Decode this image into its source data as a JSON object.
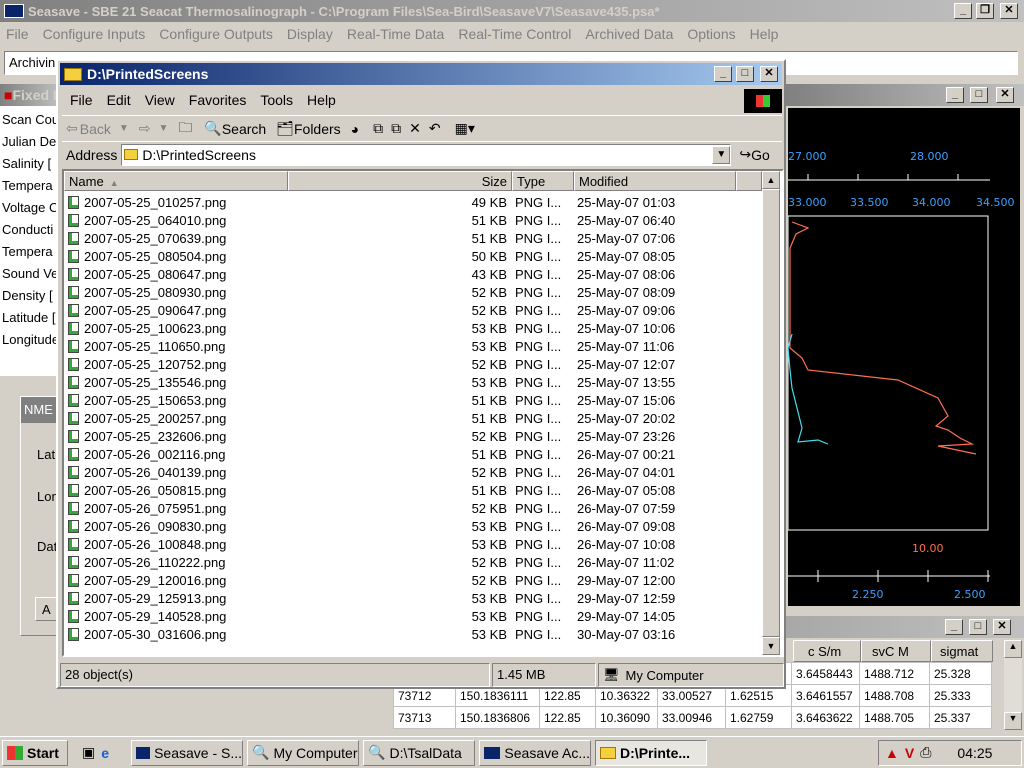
{
  "seasave": {
    "title": "Seasave - SBE 21 Seacat Thermosalinograph - C:\\Program Files\\Sea-Bird\\SeasaveV7\\Seasave435.psa*",
    "menu": [
      "File",
      "Configure Inputs",
      "Configure Outputs",
      "Display",
      "Real-Time Data",
      "Real-Time Control",
      "Archived Data",
      "Options",
      "Help"
    ],
    "status": "Archivin",
    "fixed_title": "Fixed D",
    "fixed_labels": [
      "Scan Cou",
      "Julian De",
      "Salinity [",
      "Tempera",
      "Voltage C",
      "Conducti",
      "Tempera",
      "Sound Ve",
      "Density [",
      "Latitude [",
      "Longitude"
    ],
    "nmea": {
      "title": "NME",
      "labels": [
        "Lati",
        "Lon",
        "Dat"
      ],
      "button": "A"
    },
    "plot": {
      "top_ticks1": [
        "27.000",
        "28.000"
      ],
      "top_ticks2": [
        "33.000",
        "33.500",
        "34.000",
        "34.500"
      ],
      "bottom_ticks1": [
        "10.00"
      ],
      "bottom_ticks2": [
        "2.250",
        "2.500"
      ]
    },
    "grid": {
      "headers": [
        "c S/m",
        "svC M",
        "sigmat"
      ],
      "rows": [
        [
          "",
          "",
          "",
          "",
          "",
          "",
          "3.6458443",
          "1488.712",
          "25.328"
        ],
        [
          "73712",
          "150.1836111",
          "122.85",
          "10.36322",
          "33.00527",
          "1.62515",
          "3.6461557",
          "1488.708",
          "25.333"
        ],
        [
          "73713",
          "150.1836806",
          "122.85",
          "10.36090",
          "33.00946",
          "1.62759",
          "3.6463622",
          "1488.705",
          "25.337"
        ]
      ]
    }
  },
  "explorer": {
    "title": "D:\\PrintedScreens",
    "menu": [
      "File",
      "Edit",
      "View",
      "Favorites",
      "Tools",
      "Help"
    ],
    "toolbar": {
      "back": "Back",
      "search": "Search",
      "folders": "Folders"
    },
    "address_label": "Address",
    "address": "D:\\PrintedScreens",
    "go": "Go",
    "columns": [
      "Name",
      "Size",
      "Type",
      "Modified"
    ],
    "files": [
      [
        "2007-05-25_010257.png",
        "49 KB",
        "PNG I...",
        "25-May-07 01:03"
      ],
      [
        "2007-05-25_064010.png",
        "51 KB",
        "PNG I...",
        "25-May-07 06:40"
      ],
      [
        "2007-05-25_070639.png",
        "51 KB",
        "PNG I...",
        "25-May-07 07:06"
      ],
      [
        "2007-05-25_080504.png",
        "50 KB",
        "PNG I...",
        "25-May-07 08:05"
      ],
      [
        "2007-05-25_080647.png",
        "43 KB",
        "PNG I...",
        "25-May-07 08:06"
      ],
      [
        "2007-05-25_080930.png",
        "52 KB",
        "PNG I...",
        "25-May-07 08:09"
      ],
      [
        "2007-05-25_090647.png",
        "52 KB",
        "PNG I...",
        "25-May-07 09:06"
      ],
      [
        "2007-05-25_100623.png",
        "53 KB",
        "PNG I...",
        "25-May-07 10:06"
      ],
      [
        "2007-05-25_110650.png",
        "53 KB",
        "PNG I...",
        "25-May-07 11:06"
      ],
      [
        "2007-05-25_120752.png",
        "52 KB",
        "PNG I...",
        "25-May-07 12:07"
      ],
      [
        "2007-05-25_135546.png",
        "53 KB",
        "PNG I...",
        "25-May-07 13:55"
      ],
      [
        "2007-05-25_150653.png",
        "51 KB",
        "PNG I...",
        "25-May-07 15:06"
      ],
      [
        "2007-05-25_200257.png",
        "51 KB",
        "PNG I...",
        "25-May-07 20:02"
      ],
      [
        "2007-05-25_232606.png",
        "52 KB",
        "PNG I...",
        "25-May-07 23:26"
      ],
      [
        "2007-05-26_002116.png",
        "51 KB",
        "PNG I...",
        "26-May-07 00:21"
      ],
      [
        "2007-05-26_040139.png",
        "52 KB",
        "PNG I...",
        "26-May-07 04:01"
      ],
      [
        "2007-05-26_050815.png",
        "51 KB",
        "PNG I...",
        "26-May-07 05:08"
      ],
      [
        "2007-05-26_075951.png",
        "52 KB",
        "PNG I...",
        "26-May-07 07:59"
      ],
      [
        "2007-05-26_090830.png",
        "53 KB",
        "PNG I...",
        "26-May-07 09:08"
      ],
      [
        "2007-05-26_100848.png",
        "53 KB",
        "PNG I...",
        "26-May-07 10:08"
      ],
      [
        "2007-05-26_110222.png",
        "52 KB",
        "PNG I...",
        "26-May-07 11:02"
      ],
      [
        "2007-05-29_120016.png",
        "52 KB",
        "PNG I...",
        "29-May-07 12:00"
      ],
      [
        "2007-05-29_125913.png",
        "53 KB",
        "PNG I...",
        "29-May-07 12:59"
      ],
      [
        "2007-05-29_140528.png",
        "53 KB",
        "PNG I...",
        "29-May-07 14:05"
      ],
      [
        "2007-05-30_031606.png",
        "53 KB",
        "PNG I...",
        "30-May-07 03:16"
      ]
    ],
    "status": {
      "objects": "28 object(s)",
      "size": "1.45 MB",
      "zone": "My Computer"
    }
  },
  "taskbar": {
    "start": "Start",
    "tasks": [
      "Seasave - S...",
      "My Computer",
      "D:\\TsalData",
      "Seasave Ac...",
      "D:\\Printe..."
    ],
    "clock": "04:25"
  }
}
